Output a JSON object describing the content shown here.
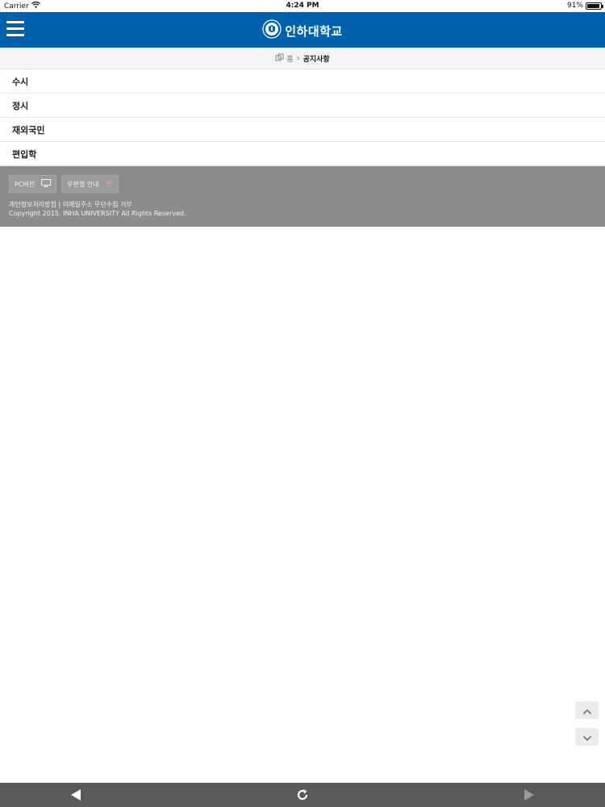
{
  "status_bar": {
    "carrier": "Carrier",
    "time": "4:24 PM",
    "battery": "91%",
    "battery_level": 0.91,
    "icons": [
      "wifi-icon",
      "battery-icon"
    ]
  },
  "header": {
    "title": "인하대학교",
    "menu_icon": "hamburger-icon",
    "logo_icon": "university-emblem-icon",
    "background": "#0062ad"
  },
  "breadcrumb": {
    "home": "홈",
    "current": "공지사항",
    "home_icon": "home-icon"
  },
  "menu": {
    "items": [
      {
        "label": "수시"
      },
      {
        "label": "정시"
      },
      {
        "label": "재외국민"
      },
      {
        "label": "편입학"
      }
    ]
  },
  "footer": {
    "pc_version": "PC버전",
    "mail_guide": "우편행 안내",
    "privacy_policy": "개인정보처리방침",
    "email_refusal": "이메일주소 무단수집 거부",
    "separator": "|",
    "copyright": "Copyright 2015. INHA UNIVERSITY All Rights Reserved.",
    "background": "#8c8c8c"
  },
  "scroll_controls": {
    "up_icon": "chevron-up-icon",
    "down_icon": "chevron-down-icon"
  },
  "browser_toolbar": {
    "icons": [
      "back-arrow-icon",
      "reload-icon",
      "forward-arrow-icon"
    ]
  }
}
